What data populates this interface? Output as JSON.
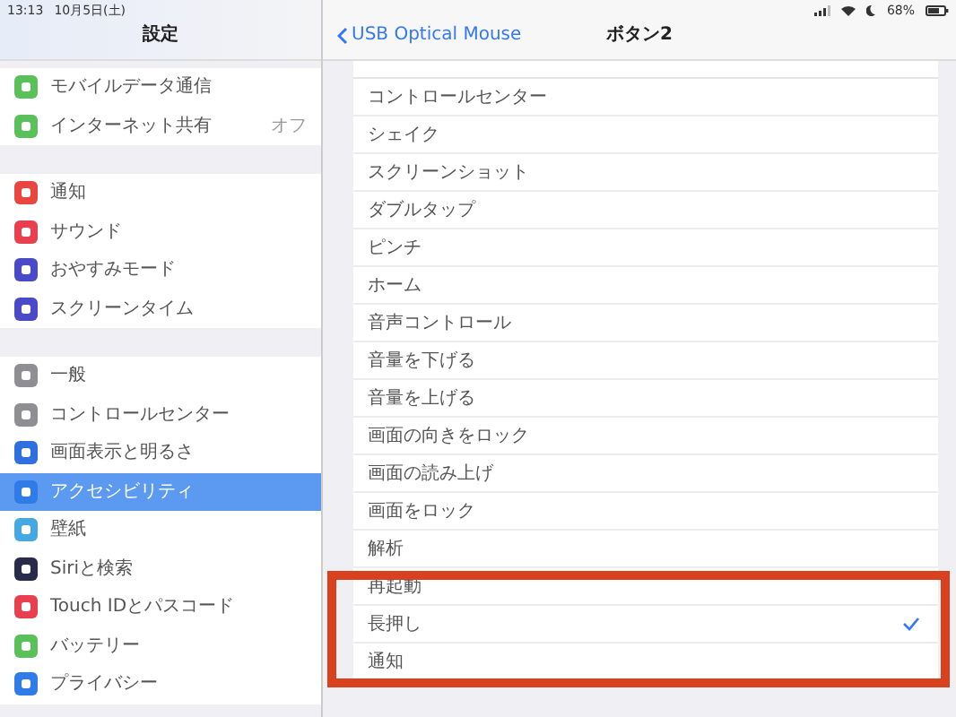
{
  "status_bar": {
    "time": "13:13",
    "date": "10月5日(土)",
    "battery": "68%"
  },
  "sidebar": {
    "title": "設定",
    "groups": [
      {
        "items": [
          {
            "label": "モバイルデータ通信",
            "color": "#5ac05a",
            "selected": false
          },
          {
            "label": "インターネット共有",
            "value": "オフ",
            "color": "#5ac05a",
            "selected": false
          }
        ]
      },
      {
        "items": [
          {
            "label": "通知",
            "color": "#e8463e",
            "selected": false
          },
          {
            "label": "サウンド",
            "color": "#e8404e",
            "selected": false
          },
          {
            "label": "おやすみモード",
            "color": "#4a4ac8",
            "selected": false
          },
          {
            "label": "スクリーンタイム",
            "color": "#4a4ac8",
            "selected": false
          }
        ]
      },
      {
        "items": [
          {
            "label": "一般",
            "color": "#8e8e93",
            "selected": false
          },
          {
            "label": "コントロールセンター",
            "color": "#8e8e93",
            "selected": false
          },
          {
            "label": "画面表示と明るさ",
            "color": "#2f6fe0",
            "selected": false
          },
          {
            "label": "アクセシビリティ",
            "color": "#2f7be8",
            "selected": true
          },
          {
            "label": "壁紙",
            "color": "#45a8e0",
            "selected": false
          },
          {
            "label": "Siriと検索",
            "color": "#2a2a4a",
            "selected": false
          },
          {
            "label": "Touch IDとパスコード",
            "color": "#e8404e",
            "selected": false
          },
          {
            "label": "バッテリー",
            "color": "#5ac05a",
            "selected": false
          },
          {
            "label": "プライバシー",
            "color": "#2f7be8",
            "selected": false
          }
        ]
      }
    ]
  },
  "detail": {
    "back": "USB Optical Mouse",
    "title": "ボタン2",
    "options": [
      {
        "label": "コントロールセンター",
        "checked": false
      },
      {
        "label": "シェイク",
        "checked": false
      },
      {
        "label": "スクリーンショット",
        "checked": false
      },
      {
        "label": "ダブルタップ",
        "checked": false
      },
      {
        "label": "ピンチ",
        "checked": false
      },
      {
        "label": "ホーム",
        "checked": false
      },
      {
        "label": "音声コントロール",
        "checked": false
      },
      {
        "label": "音量を下げる",
        "checked": false
      },
      {
        "label": "音量を上げる",
        "checked": false
      },
      {
        "label": "画面の向きをロック",
        "checked": false
      },
      {
        "label": "画面の読み上げ",
        "checked": false
      },
      {
        "label": "画面をロック",
        "checked": false
      },
      {
        "label": "解析",
        "checked": false
      },
      {
        "label": "再起動",
        "checked": false
      },
      {
        "label": "長押し",
        "checked": true
      },
      {
        "label": "通知",
        "checked": false
      }
    ]
  }
}
